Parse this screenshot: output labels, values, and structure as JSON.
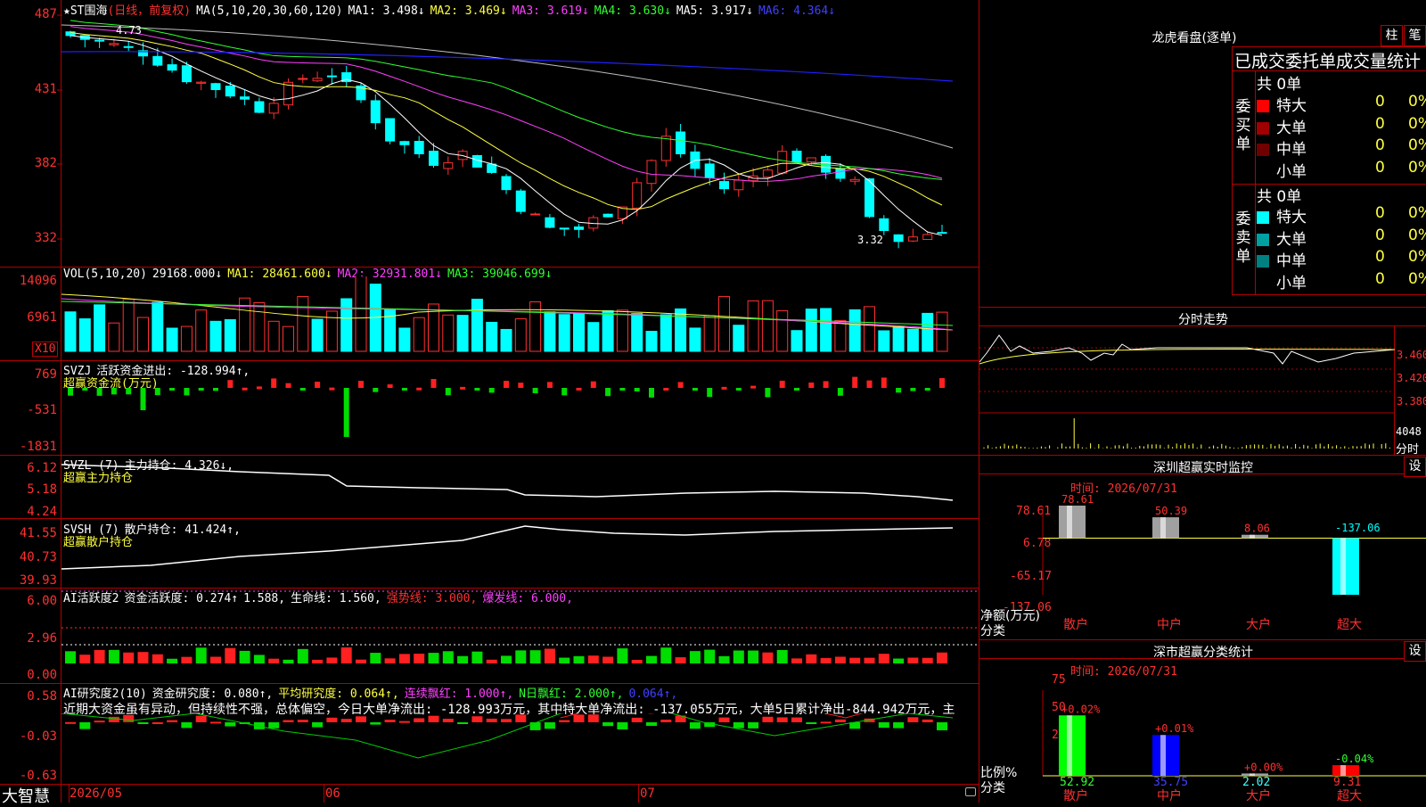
{
  "main_chart": {
    "header": {
      "name": "★ST围海",
      "period": "(日线，前复权)",
      "ma_label": "MA(5,10,20,30,60,120)",
      "ma1": "MA1: 3.498↓",
      "ma2": "MA2: 3.469↓",
      "ma3": "MA3: 3.619↓",
      "ma4": "MA4: 3.630↓",
      "ma5": "MA5: 3.917↓",
      "ma6": "MA6: 4.364↓"
    },
    "y_ticks": [
      "487",
      "431",
      "382",
      "332"
    ],
    "high_marker": "4.73",
    "low_marker": "3.32"
  },
  "volume": {
    "header": {
      "label": "VOL(5,10,20)",
      "value": "29168.000↓",
      "ma1": "MA1: 28461.600↓",
      "ma2": "MA2: 32931.801↓",
      "ma3": "MA3: 39046.699↓"
    },
    "y_ticks": [
      "14096",
      "6961"
    ],
    "unit": "X10"
  },
  "svzj": {
    "header": {
      "label": "SVZJ",
      "text": "活跃资金进出: -128.994↑,",
      "sub": "超赢资金流(万元)"
    },
    "y_ticks": [
      "769",
      "-531",
      "-1831"
    ]
  },
  "svzl": {
    "header": {
      "label": "SVZL (7)",
      "text": "主力持仓: 4.326↓,",
      "sub": "超赢主力持仓"
    },
    "y_ticks": [
      "6.12",
      "5.18",
      "4.24"
    ]
  },
  "svsh": {
    "header": {
      "label": "SVSH (7)",
      "text": "散户持仓: 41.424↑,",
      "sub": "超赢散户持仓"
    },
    "y_ticks": [
      "41.55",
      "40.73",
      "39.93"
    ]
  },
  "ai_active": {
    "header": {
      "label": "AI活跃度2",
      "t1": "资金活跃度: 0.274↑",
      "t2": "1.588,",
      "t3": "生命线: 1.560,",
      "t4": "强势线: 3.000,",
      "t5": "爆发线: 6.000,"
    },
    "y_ticks": [
      "6.00",
      "2.96",
      "0.00"
    ]
  },
  "ai_research": {
    "header": {
      "label": "AI研究度2(10)",
      "t1": "资金研究度: 0.080↑,",
      "t2": "平均研究度: 0.064↑,",
      "t3": "连续飘红: 1.000↑,",
      "t4": "N日飘红: 2.000↑,",
      "t5": "0.064↑,"
    },
    "comment": "近期大资金虽有异动，但持续性不强，总体偏空，今日大单净流出: -128.993万元，其中特大单净流出: -137.055万元，大单5日累计净出-844.942万元，主",
    "y_ticks": [
      "0.58",
      "-0.03",
      "-0.63"
    ]
  },
  "footer": {
    "brand": "大智慧",
    "dates": [
      "2026/05",
      "06",
      "07"
    ]
  },
  "dragon_tiger": {
    "title": "龙虎看盘(逐单)",
    "btn_bar": "柱",
    "btn_pen": "笔",
    "subtitle": "已成交委托单成交量统计",
    "buy": {
      "side_label": "委买单",
      "total": "共 0单",
      "rows": [
        {
          "label": "特大",
          "count": "0",
          "pct": "0%",
          "color": "#ff0000"
        },
        {
          "label": "大单",
          "count": "0",
          "pct": "0%",
          "color": "#a00000"
        },
        {
          "label": "中单",
          "count": "0",
          "pct": "0%",
          "color": "#700000"
        },
        {
          "label": "小单",
          "count": "0",
          "pct": "0%",
          "color": ""
        }
      ]
    },
    "sell": {
      "side_label": "委卖单",
      "total": "共 0单",
      "rows": [
        {
          "label": "特大",
          "count": "0",
          "pct": "0%",
          "color": "#00ffff"
        },
        {
          "label": "大单",
          "count": "0",
          "pct": "0%",
          "color": "#00a0a0"
        },
        {
          "label": "中单",
          "count": "0",
          "pct": "0%",
          "color": "#008080"
        },
        {
          "label": "小单",
          "count": "0",
          "pct": "0%",
          "color": ""
        }
      ]
    }
  },
  "intraday": {
    "title": "分时走势",
    "y_ticks": [
      "3.460",
      "3.420",
      "3.380"
    ],
    "vol_label": "4048",
    "vol_sub": "分时"
  },
  "sz_monitor": {
    "title": "深圳超赢实时监控",
    "set_btn": "设",
    "time": "时间: 2026/07/31",
    "y_ticks": [
      "78.61",
      "6.78",
      "-65.17",
      "-137.06"
    ],
    "y_axis_name": "净额(万元)",
    "x_axis_name": "分类",
    "chart_data": {
      "type": "bar",
      "categories": [
        "散户",
        "中户",
        "大户",
        "超大"
      ],
      "values": [
        78.61,
        50.39,
        8.06,
        -137.06
      ],
      "value_labels": [
        "78.61",
        "50.39",
        "8.06",
        "-137.06"
      ],
      "ylim": [
        -137.06,
        78.61
      ]
    }
  },
  "sz_class": {
    "title": "深市超赢分类统计",
    "set_btn": "设",
    "time": "时间: 2026/07/31",
    "y_ticks": [
      "75",
      "50",
      "25",
      "0"
    ],
    "y_axis_name": "比例%",
    "x_axis_name": "分类",
    "chart_data": {
      "type": "bar",
      "categories": [
        "散户",
        "中户",
        "大户",
        "超大"
      ],
      "values": [
        52.92,
        35.75,
        2.02,
        9.31
      ],
      "changes": [
        "+0.02%",
        "+0.01%",
        "+0.00%",
        "-0.04%"
      ],
      "value_labels": [
        "52.92",
        "35.75",
        "2.02",
        "9.31"
      ],
      "ylim": [
        0,
        75
      ]
    }
  }
}
